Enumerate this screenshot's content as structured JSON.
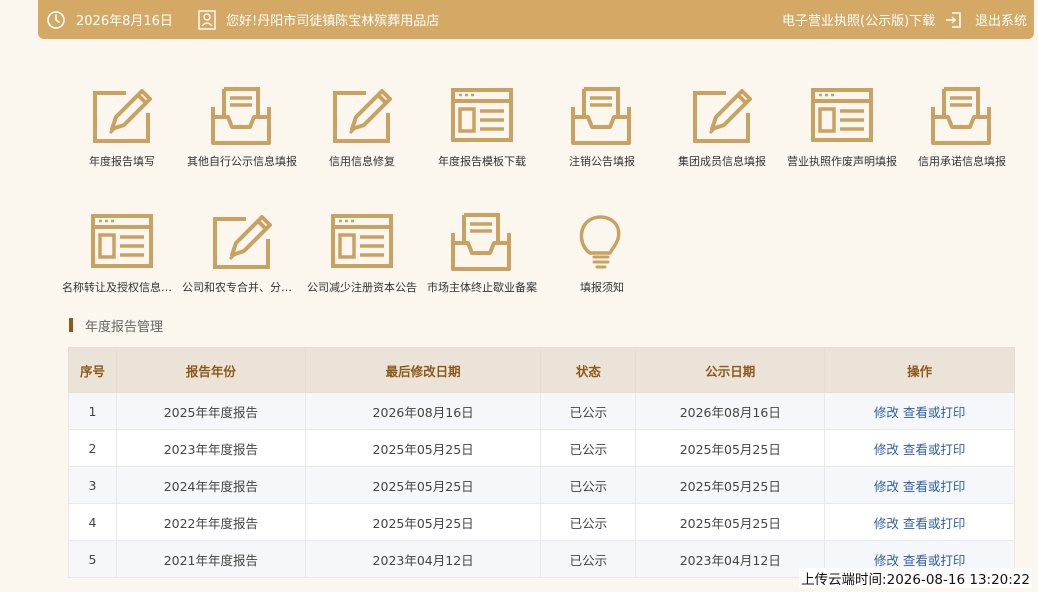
{
  "header": {
    "date": "2026年8月16日",
    "greeting": "您好!丹阳市司徒镇陈宝林殡葬用品店",
    "license_download": "电子营业执照(公示版)下载",
    "logout": "退出系统"
  },
  "colors": {
    "accent": "#d3a965",
    "title_bar": "#8b5a1a",
    "link": "#2d5fa8"
  },
  "menu": [
    {
      "label": "年度报告填写",
      "icon": "edit-icon"
    },
    {
      "label": "其他自行公示信息填报",
      "icon": "inbox-icon"
    },
    {
      "label": "信用信息修复",
      "icon": "edit-icon"
    },
    {
      "label": "年度报告模板下载",
      "icon": "template-icon"
    },
    {
      "label": "注销公告填报",
      "icon": "inbox-icon"
    },
    {
      "label": "集团成员信息填报",
      "icon": "edit-icon"
    },
    {
      "label": "营业执照作废声明填报",
      "icon": "template-icon"
    },
    {
      "label": "信用承诺信息填报",
      "icon": "inbox-icon"
    },
    {
      "label": "名称转让及授权信息填报",
      "icon": "template-icon"
    },
    {
      "label": "公司和农专合并、分立公告",
      "icon": "edit-icon"
    },
    {
      "label": "公司减少注册资本公告",
      "icon": "template-icon"
    },
    {
      "label": "市场主体终止歇业备案",
      "icon": "inbox-icon"
    },
    {
      "label": "填报须知",
      "icon": "lightbulb-icon"
    }
  ],
  "section_title": "年度报告管理",
  "table": {
    "headers": [
      "序号",
      "报告年份",
      "最后修改日期",
      "状态",
      "公示日期",
      "操作"
    ],
    "rows": [
      {
        "no": "1",
        "year": "2025年年度报告",
        "modified": "2026年08月16日",
        "status": "已公示",
        "published": "2026年08月16日"
      },
      {
        "no": "2",
        "year": "2023年年度报告",
        "modified": "2025年05月25日",
        "status": "已公示",
        "published": "2025年05月25日"
      },
      {
        "no": "3",
        "year": "2024年年度报告",
        "modified": "2025年05月25日",
        "status": "已公示",
        "published": "2025年05月25日"
      },
      {
        "no": "4",
        "year": "2022年年度报告",
        "modified": "2025年05月25日",
        "status": "已公示",
        "published": "2025年05月25日"
      },
      {
        "no": "5",
        "year": "2021年年度报告",
        "modified": "2023年04月12日",
        "status": "已公示",
        "published": "2023年04月12日"
      }
    ],
    "action_edit": "修改",
    "action_view": "查看或打印"
  },
  "upload_time": "上传云端时间:2026-08-16 13:20:22"
}
